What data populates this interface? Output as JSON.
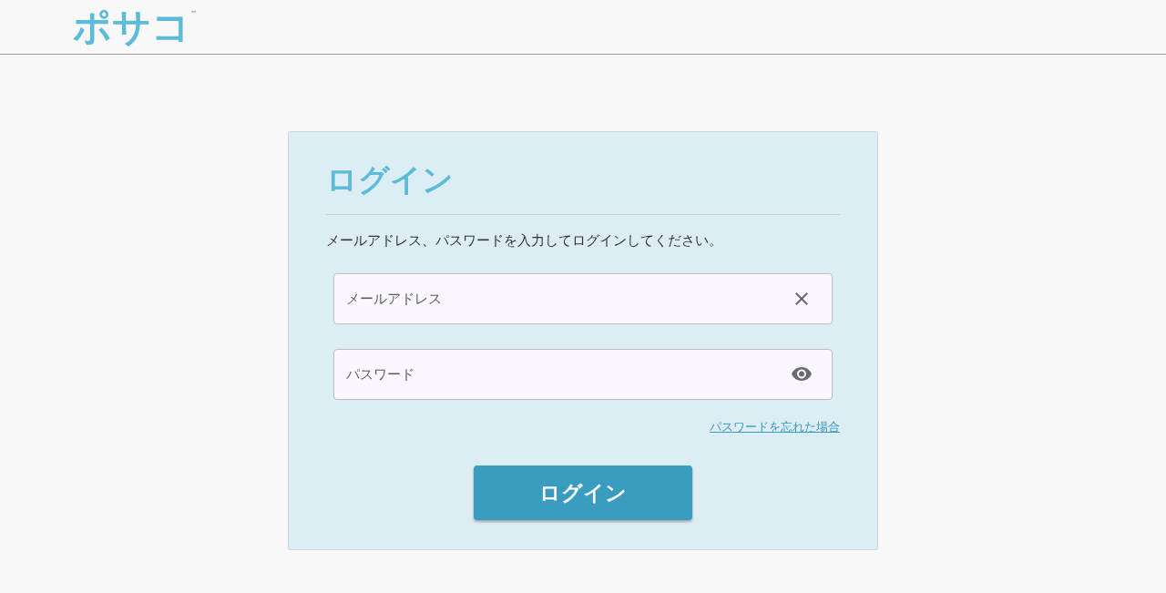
{
  "header": {
    "logo": {
      "text": "ポサコ",
      "mark": "™"
    }
  },
  "login": {
    "title": "ログイン",
    "description": "メールアドレス、パスワードを入力してログインしてください。",
    "fields": [
      {
        "kind": "email",
        "placeholder": "メールアドレス"
      },
      {
        "kind": "password",
        "placeholder": "パスワード"
      }
    ],
    "forgot_link": "パスワードを忘れた場合",
    "submit": "ログイン"
  }
}
